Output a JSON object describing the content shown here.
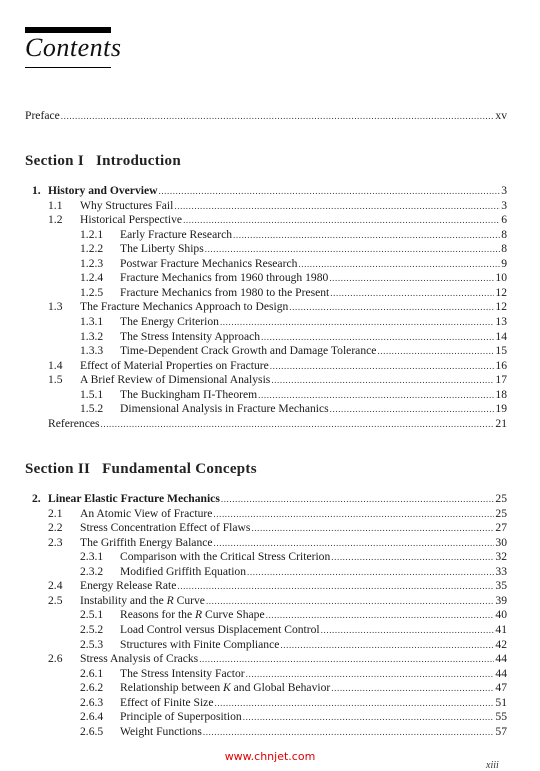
{
  "header": {
    "title": "Contents"
  },
  "preface": {
    "title": "Preface",
    "page": "xv"
  },
  "sections": [
    {
      "label": "Section I",
      "name": "Introduction",
      "chapter": {
        "num": "1.",
        "title": "History and Overview",
        "page": "3"
      },
      "entries": [
        {
          "level": 2,
          "num": "1.1",
          "title": "Why Structures Fail",
          "page": "3"
        },
        {
          "level": 2,
          "num": "1.2",
          "title": "Historical Perspective",
          "page": "6"
        },
        {
          "level": 3,
          "num": "1.2.1",
          "title": "Early Fracture Research",
          "page": "8"
        },
        {
          "level": 3,
          "num": "1.2.2",
          "title": "The Liberty Ships",
          "page": "8"
        },
        {
          "level": 3,
          "num": "1.2.3",
          "title": "Postwar Fracture Mechanics Research",
          "page": "9"
        },
        {
          "level": 3,
          "num": "1.2.4",
          "title": "Fracture Mechanics from 1960 through 1980",
          "page": "10"
        },
        {
          "level": 3,
          "num": "1.2.5",
          "title": "Fracture Mechanics from 1980 to the Present",
          "page": "12"
        },
        {
          "level": 2,
          "num": "1.3",
          "title": "The Fracture Mechanics Approach to Design",
          "page": "12"
        },
        {
          "level": 3,
          "num": "1.3.1",
          "title": "The Energy Criterion",
          "page": "13"
        },
        {
          "level": 3,
          "num": "1.3.2",
          "title": "The Stress Intensity Approach",
          "page": "14"
        },
        {
          "level": 3,
          "num": "1.3.3",
          "title": "Time-Dependent Crack Growth and Damage Tolerance",
          "page": "15"
        },
        {
          "level": 2,
          "num": "1.4",
          "title": "Effect of Material Properties on Fracture",
          "page": "16"
        },
        {
          "level": 2,
          "num": "1.5",
          "title": "A Brief Review of Dimensional Analysis",
          "page": "17"
        },
        {
          "level": 3,
          "num": "1.5.1",
          "title": "The Buckingham Π-Theorem",
          "page": "18"
        },
        {
          "level": 3,
          "num": "1.5.2",
          "title": "Dimensional Analysis in Fracture Mechanics",
          "page": "19"
        },
        {
          "level": 1,
          "num": "",
          "title": "References",
          "page": "21"
        }
      ]
    },
    {
      "label": "Section II",
      "name": "Fundamental Concepts",
      "chapter": {
        "num": "2.",
        "title": "Linear Elastic Fracture Mechanics",
        "page": "25"
      },
      "entries": [
        {
          "level": 2,
          "num": "2.1",
          "title": "An Atomic View of Fracture",
          "page": "25"
        },
        {
          "level": 2,
          "num": "2.2",
          "title": "Stress Concentration Effect of Flaws",
          "page": "27"
        },
        {
          "level": 2,
          "num": "2.3",
          "title": "The Griffith Energy Balance",
          "page": "30"
        },
        {
          "level": 3,
          "num": "2.3.1",
          "title": "Comparison with the Critical Stress Criterion",
          "page": "32"
        },
        {
          "level": 3,
          "num": "2.3.2",
          "title": "Modified Griffith Equation",
          "page": "33"
        },
        {
          "level": 2,
          "num": "2.4",
          "title": "Energy Release Rate",
          "page": "35"
        },
        {
          "level": 2,
          "num": "2.5",
          "title": "Instability and the R Curve",
          "page": "39"
        },
        {
          "level": 3,
          "num": "2.5.1",
          "title": "Reasons for the R Curve Shape",
          "page": "40"
        },
        {
          "level": 3,
          "num": "2.5.2",
          "title": "Load Control versus Displacement Control",
          "page": "41"
        },
        {
          "level": 3,
          "num": "2.5.3",
          "title": "Structures with Finite Compliance",
          "page": "42"
        },
        {
          "level": 2,
          "num": "2.6",
          "title": "Stress Analysis of Cracks",
          "page": "44"
        },
        {
          "level": 3,
          "num": "2.6.1",
          "title": "The Stress Intensity Factor",
          "page": "44"
        },
        {
          "level": 3,
          "num": "2.6.2",
          "title": "Relationship between K and Global Behavior",
          "page": "47"
        },
        {
          "level": 3,
          "num": "2.6.3",
          "title": "Effect of Finite Size",
          "page": "51"
        },
        {
          "level": 3,
          "num": "2.6.4",
          "title": "Principle of Superposition",
          "page": "55"
        },
        {
          "level": 3,
          "num": "2.6.5",
          "title": "Weight Functions",
          "page": "57"
        }
      ]
    }
  ],
  "watermark": "www.chnjet.com",
  "footer": {
    "page_number": "xiii"
  }
}
